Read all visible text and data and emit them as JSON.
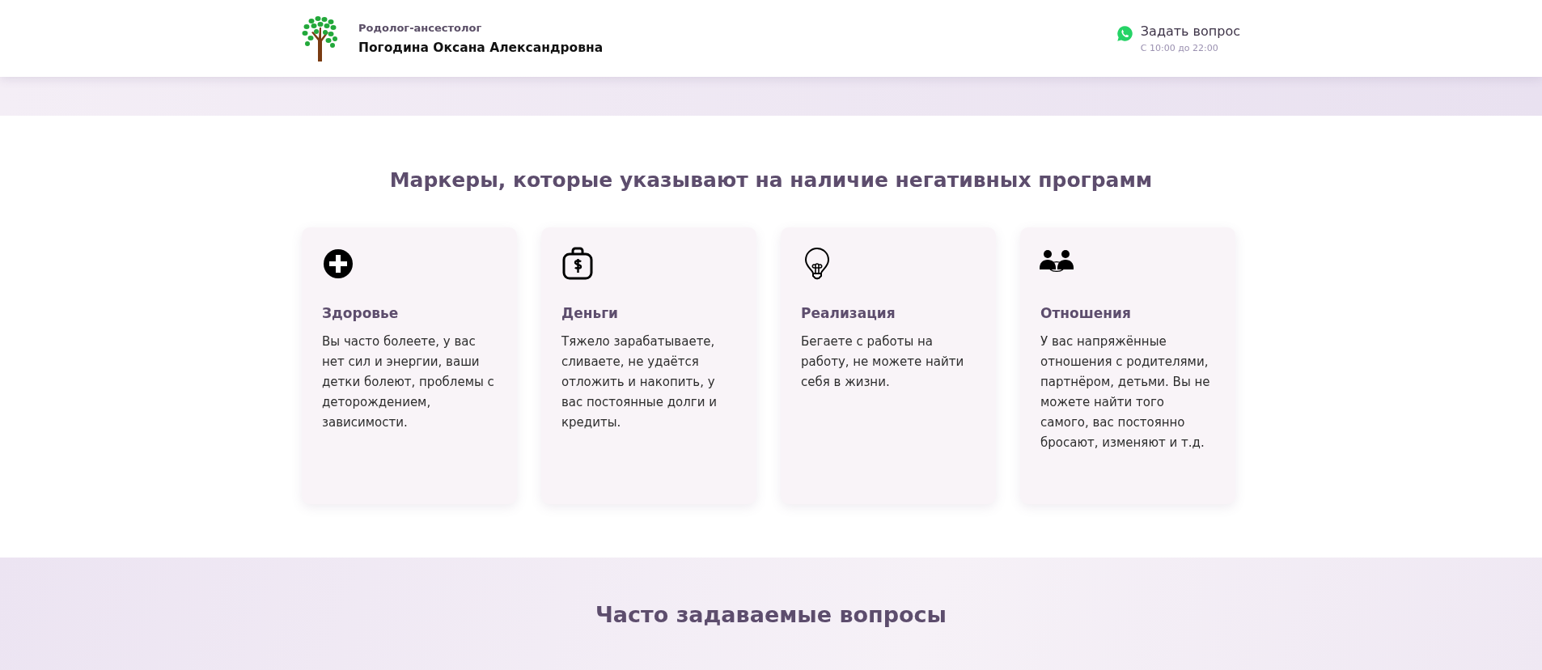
{
  "header": {
    "subtitle": "Родолог-ансестолог",
    "name": "Погодина Оксана Александровна",
    "contact": {
      "label": "Задать вопрос",
      "hours": "С 10:00 до 22:00"
    }
  },
  "markers": {
    "title": "Маркеры, которые указывают на наличие негативных программ",
    "cards": [
      {
        "kind": "health",
        "title": "Здоровье",
        "text": "Вы часто болеете, у вас нет сил и энергии, ваши детки болеют, проблемы с деторождением, зависимости."
      },
      {
        "kind": "money",
        "title": "Деньги",
        "text": "Тяжело зарабатываете, сливаете, не удаётся отложить и накопить, у вас постоянные долги и кредиты."
      },
      {
        "kind": "idea",
        "title": "Реализация",
        "text": "Бегаете с работы на работу, не можете найти себя в жизни."
      },
      {
        "kind": "relations",
        "title": "Отношения",
        "text": "У вас напряжённые отношения с родителями, партнёром, детьми. Вы не можете найти того самого, вас постоянно бросают, изменяют и т.д."
      }
    ]
  },
  "faq": {
    "title": "Часто задаваемые вопросы"
  }
}
